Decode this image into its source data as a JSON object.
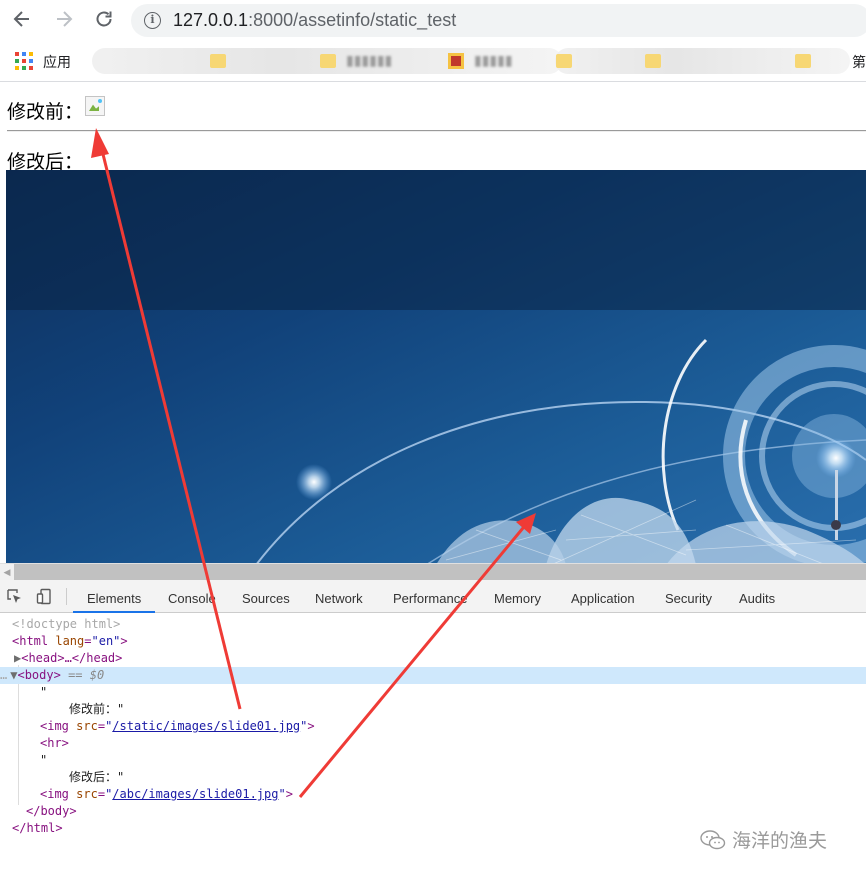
{
  "browser": {
    "back_icon": "arrow-left-icon",
    "forward_icon": "arrow-right-icon",
    "reload_icon": "reload-icon",
    "url_host": "127.0.0.1",
    "url_rest": ":8000/assetinfo/static_test"
  },
  "bookmarks": {
    "apps_label": "应用",
    "right_label": "第"
  },
  "page": {
    "before_label": "修改前：",
    "after_label": "修改后："
  },
  "devtools": {
    "tabs": [
      "Elements",
      "Console",
      "Sources",
      "Network",
      "Performance",
      "Memory",
      "Application",
      "Security",
      "Audits"
    ],
    "active_tab": "Elements",
    "dom": {
      "doctype": "<!doctype html>",
      "html_open_tag": "<html",
      "lang_attr": "lang",
      "lang_val": "\"en\"",
      "head_collapsed": "<head>…</head>",
      "body_tag": "<body>",
      "body_marker": "== $0",
      "text_before": "修改前：\"",
      "img1_src": "/static/images/slide01.jpg",
      "hr_tag": "<hr>",
      "text_after": "修改后：\"",
      "img2_src": "/abc/images/slide01.jpg",
      "body_close": "</body>",
      "html_close": "</html>"
    }
  },
  "watermark": "海洋的渔夫",
  "colors": {
    "annotation_arrow": "#ef3b36",
    "devtools_tab_underline": "#1a73e8",
    "selected_row": "#cfe8fc"
  }
}
